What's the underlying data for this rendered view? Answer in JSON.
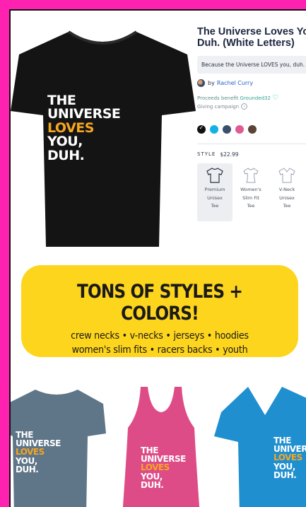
{
  "product": {
    "title_line1": "The Universe Loves You,",
    "title_line2": "Duh. (White Letters)",
    "tagline": "Because the Universe LOVES you, duh.",
    "by_prefix": "by",
    "creator": "Rachel Curry",
    "benefit_prefix": "Proceeds benefit",
    "benefit_name": "Grounded32",
    "giving": "Giving campaign",
    "style_label": "STYLE",
    "price": "$22.99",
    "colors": [
      "#111111",
      "#14b1e3",
      "#3a4f6e",
      "#e05b92",
      "#5b4436"
    ],
    "styles": [
      {
        "l1": "Premium",
        "l2": "Unisex",
        "l3": "Tee"
      },
      {
        "l1": "Women's",
        "l2": "Slim Fit",
        "l3": "Tee"
      },
      {
        "l1": "V-Neck",
        "l2": "Unisex",
        "l3": "Tee"
      }
    ]
  },
  "shirt_print": {
    "line1": "THE",
    "line2": "UNIVERSE",
    "line3": "LOVES",
    "line4": "YOU,",
    "line5": "DUH."
  },
  "banner": {
    "headline": "TONS OF STYLES + COLORS!",
    "line1": "crew necks • v-necks • jerseys • hoodies",
    "line2": "women's slim fits • racers backs • youth"
  },
  "colors": {
    "border": "#ff21b0",
    "banner": "#fed51d",
    "accent_orange": "#f5a623"
  }
}
